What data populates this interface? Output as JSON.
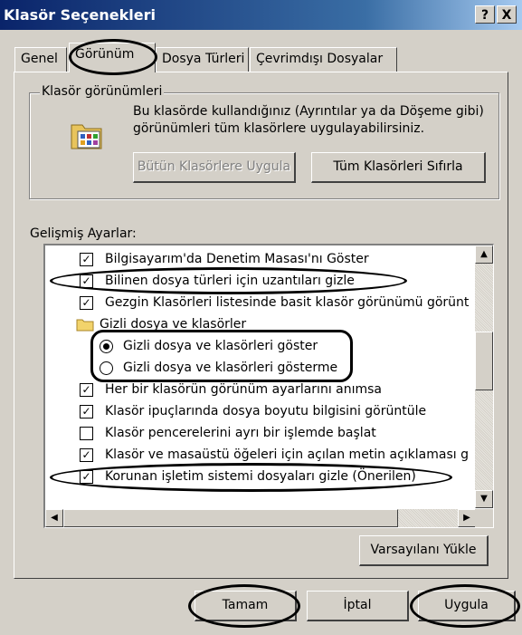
{
  "window": {
    "title": "Klasör Seçenekleri",
    "help_button": "?",
    "close_button": "X"
  },
  "tabs": [
    {
      "label": "Genel"
    },
    {
      "label": "Görünüm",
      "active": true
    },
    {
      "label": "Dosya Türleri"
    },
    {
      "label": "Çevrimdışı Dosyalar"
    }
  ],
  "folder_views": {
    "group_label": "Klasör görünümleri",
    "description": "Bu klasörde kullandığınız (Ayrıntılar ya da Döşeme gibi) görünümleri tüm klasörlere uygulayabilirsiniz.",
    "apply_all_button": "Bütün Klasörlere Uygula",
    "reset_all_button": "Tüm Klasörleri Sıfırla",
    "icon": "folder-views-icon"
  },
  "advanced": {
    "label": "Gelişmiş Ayarlar:",
    "items": [
      {
        "type": "checkbox",
        "checked": true,
        "label": "Bilgisayarım'da Denetim Masası'nı Göster"
      },
      {
        "type": "checkbox",
        "checked": true,
        "label": "Bilinen dosya türleri için uzantıları gizle"
      },
      {
        "type": "checkbox",
        "checked": true,
        "label": "Gezgin Klasörleri listesinde basit klasör görünümü görüntü"
      },
      {
        "type": "folder",
        "label": "Gizli dosya ve klasörler"
      },
      {
        "type": "radio",
        "checked": true,
        "label": "Gizli dosya ve klasörleri göster"
      },
      {
        "type": "radio",
        "checked": false,
        "label": "Gizli dosya ve klasörleri gösterme"
      },
      {
        "type": "checkbox",
        "checked": true,
        "label": "Her bir klasörün görünüm ayarlarını anımsa"
      },
      {
        "type": "checkbox",
        "checked": true,
        "label": "Klasör ipuçlarında dosya boyutu bilgisini görüntüle"
      },
      {
        "type": "checkbox",
        "checked": false,
        "label": "Klasör pencerelerini ayrı bir işlemde başlat"
      },
      {
        "type": "checkbox",
        "checked": true,
        "label": "Klasör ve masaüstü öğeleri için açılan metin açıklaması gö"
      },
      {
        "type": "checkbox",
        "checked": true,
        "label": "Korunan işletim sistemi dosyaları gizle (Önerilen)"
      }
    ],
    "restore_defaults_button": "Varsayılanı Yükle"
  },
  "footer": {
    "ok_button": "Tamam",
    "cancel_button": "İptal",
    "apply_button": "Uygula"
  },
  "colors": {
    "titlebar_start": "#0a246a",
    "titlebar_end": "#a6caf0",
    "face": "#d4d0c8"
  }
}
